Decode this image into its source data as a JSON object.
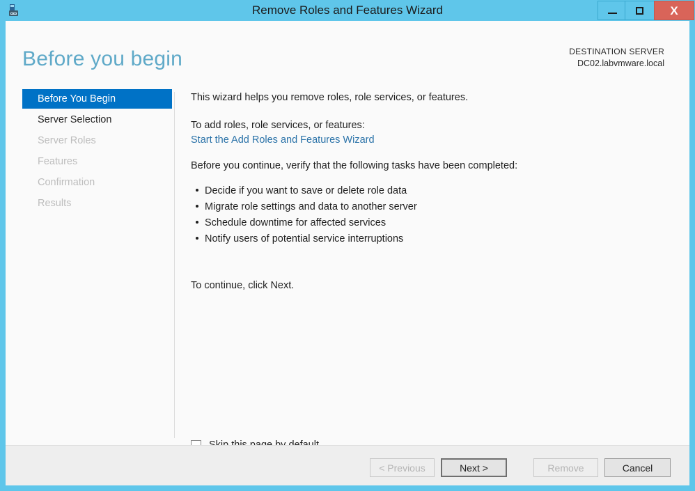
{
  "window": {
    "title": "Remove Roles and Features Wizard",
    "icon": "server-wizard-icon",
    "controls": {
      "minimize": "–",
      "maximize": "□",
      "close": "X"
    },
    "accent_color": "#5fc6ea",
    "close_color": "#d96459"
  },
  "header": {
    "page_title": "Before you begin",
    "destination_label": "DESTINATION SERVER",
    "destination_value": "DC02.labvmware.local",
    "title_color": "#5fa9c8"
  },
  "sidebar": {
    "selected_color": "#0072c6",
    "items": [
      {
        "label": "Before You Begin",
        "state": "selected"
      },
      {
        "label": "Server Selection",
        "state": "enabled"
      },
      {
        "label": "Server Roles",
        "state": "disabled"
      },
      {
        "label": "Features",
        "state": "disabled"
      },
      {
        "label": "Confirmation",
        "state": "disabled"
      },
      {
        "label": "Results",
        "state": "disabled"
      }
    ]
  },
  "content": {
    "intro": "This wizard helps you remove roles, role services, or features.",
    "to_add": "To add roles, role services, or features:",
    "add_link": "Start the Add Roles and Features Wizard",
    "link_color": "#2a72a8",
    "verify": "Before you continue, verify that the following tasks have been completed:",
    "tasks": [
      "Decide if you want to save or delete role data",
      "Migrate role settings and data to another server",
      "Schedule downtime for affected services",
      "Notify users of potential service interruptions"
    ],
    "continue": "To continue, click Next."
  },
  "skip": {
    "label": "Skip this page by default",
    "checked": false
  },
  "footer": {
    "buttons": [
      {
        "label": "< Previous",
        "state": "disabled"
      },
      {
        "label": "Next >",
        "state": "default"
      },
      {
        "label": "Remove",
        "state": "disabled"
      },
      {
        "label": "Cancel",
        "state": "enabled"
      }
    ]
  }
}
